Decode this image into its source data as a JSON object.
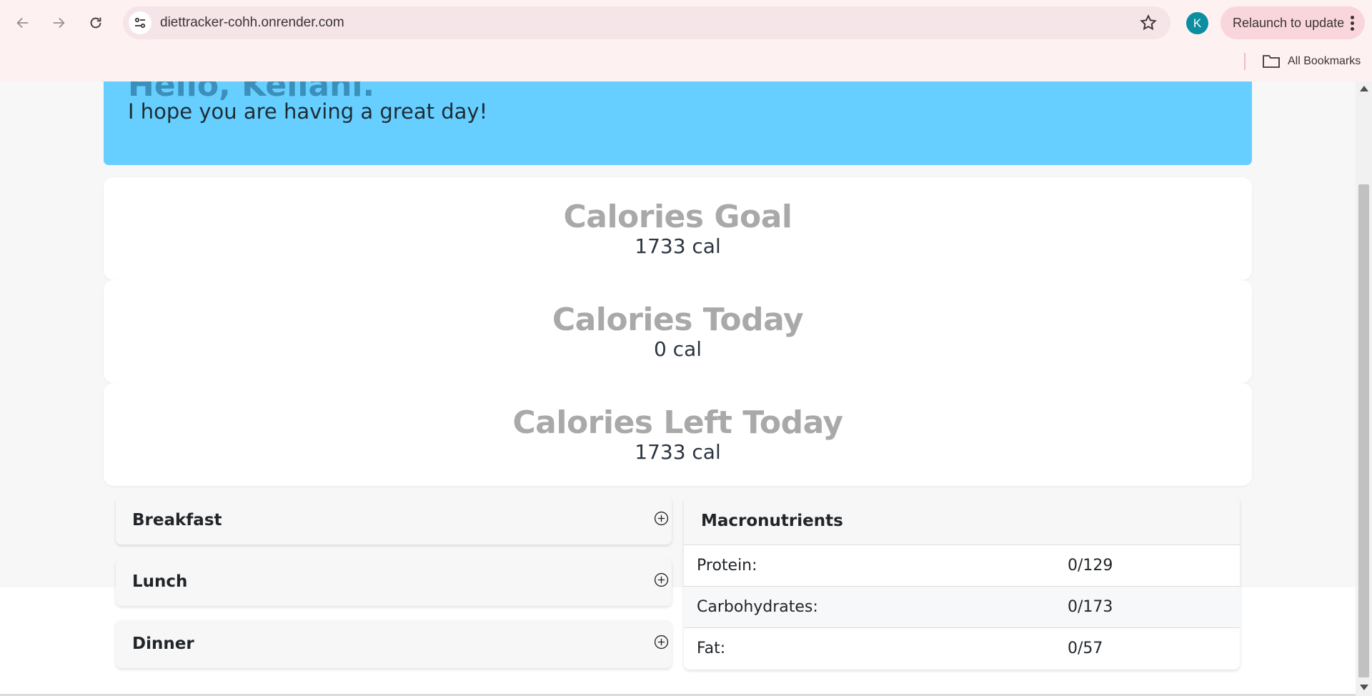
{
  "browser": {
    "url": "diettracker-cohh.onrender.com",
    "profile_initial": "K",
    "relaunch_label": "Relaunch to update",
    "bookmarks_label": "All Bookmarks"
  },
  "greeting": {
    "title": "Hello, Keilani.",
    "subtitle": "I hope you are having a great day!"
  },
  "calories": {
    "goal": {
      "title": "Calories Goal",
      "value": "1733 cal"
    },
    "today": {
      "title": "Calories Today",
      "value": "0 cal"
    },
    "left": {
      "title": "Calories Left Today",
      "value": "1733 cal"
    }
  },
  "meals": [
    {
      "label": "Breakfast"
    },
    {
      "label": "Lunch"
    },
    {
      "label": "Dinner"
    }
  ],
  "macros": {
    "title": "Macronutrients",
    "rows": [
      {
        "name": "Protein:",
        "value": "0/129"
      },
      {
        "name": "Carbohydrates:",
        "value": "0/173"
      },
      {
        "name": "Fat:",
        "value": "0/57"
      }
    ]
  },
  "colors": {
    "greeting_bg": "#66cfff",
    "greeting_title": "#3b8fba",
    "calorie_title": "#a9a9a9",
    "browser_bg": "#fef1f1",
    "avatar_bg": "#0b8ea0"
  }
}
